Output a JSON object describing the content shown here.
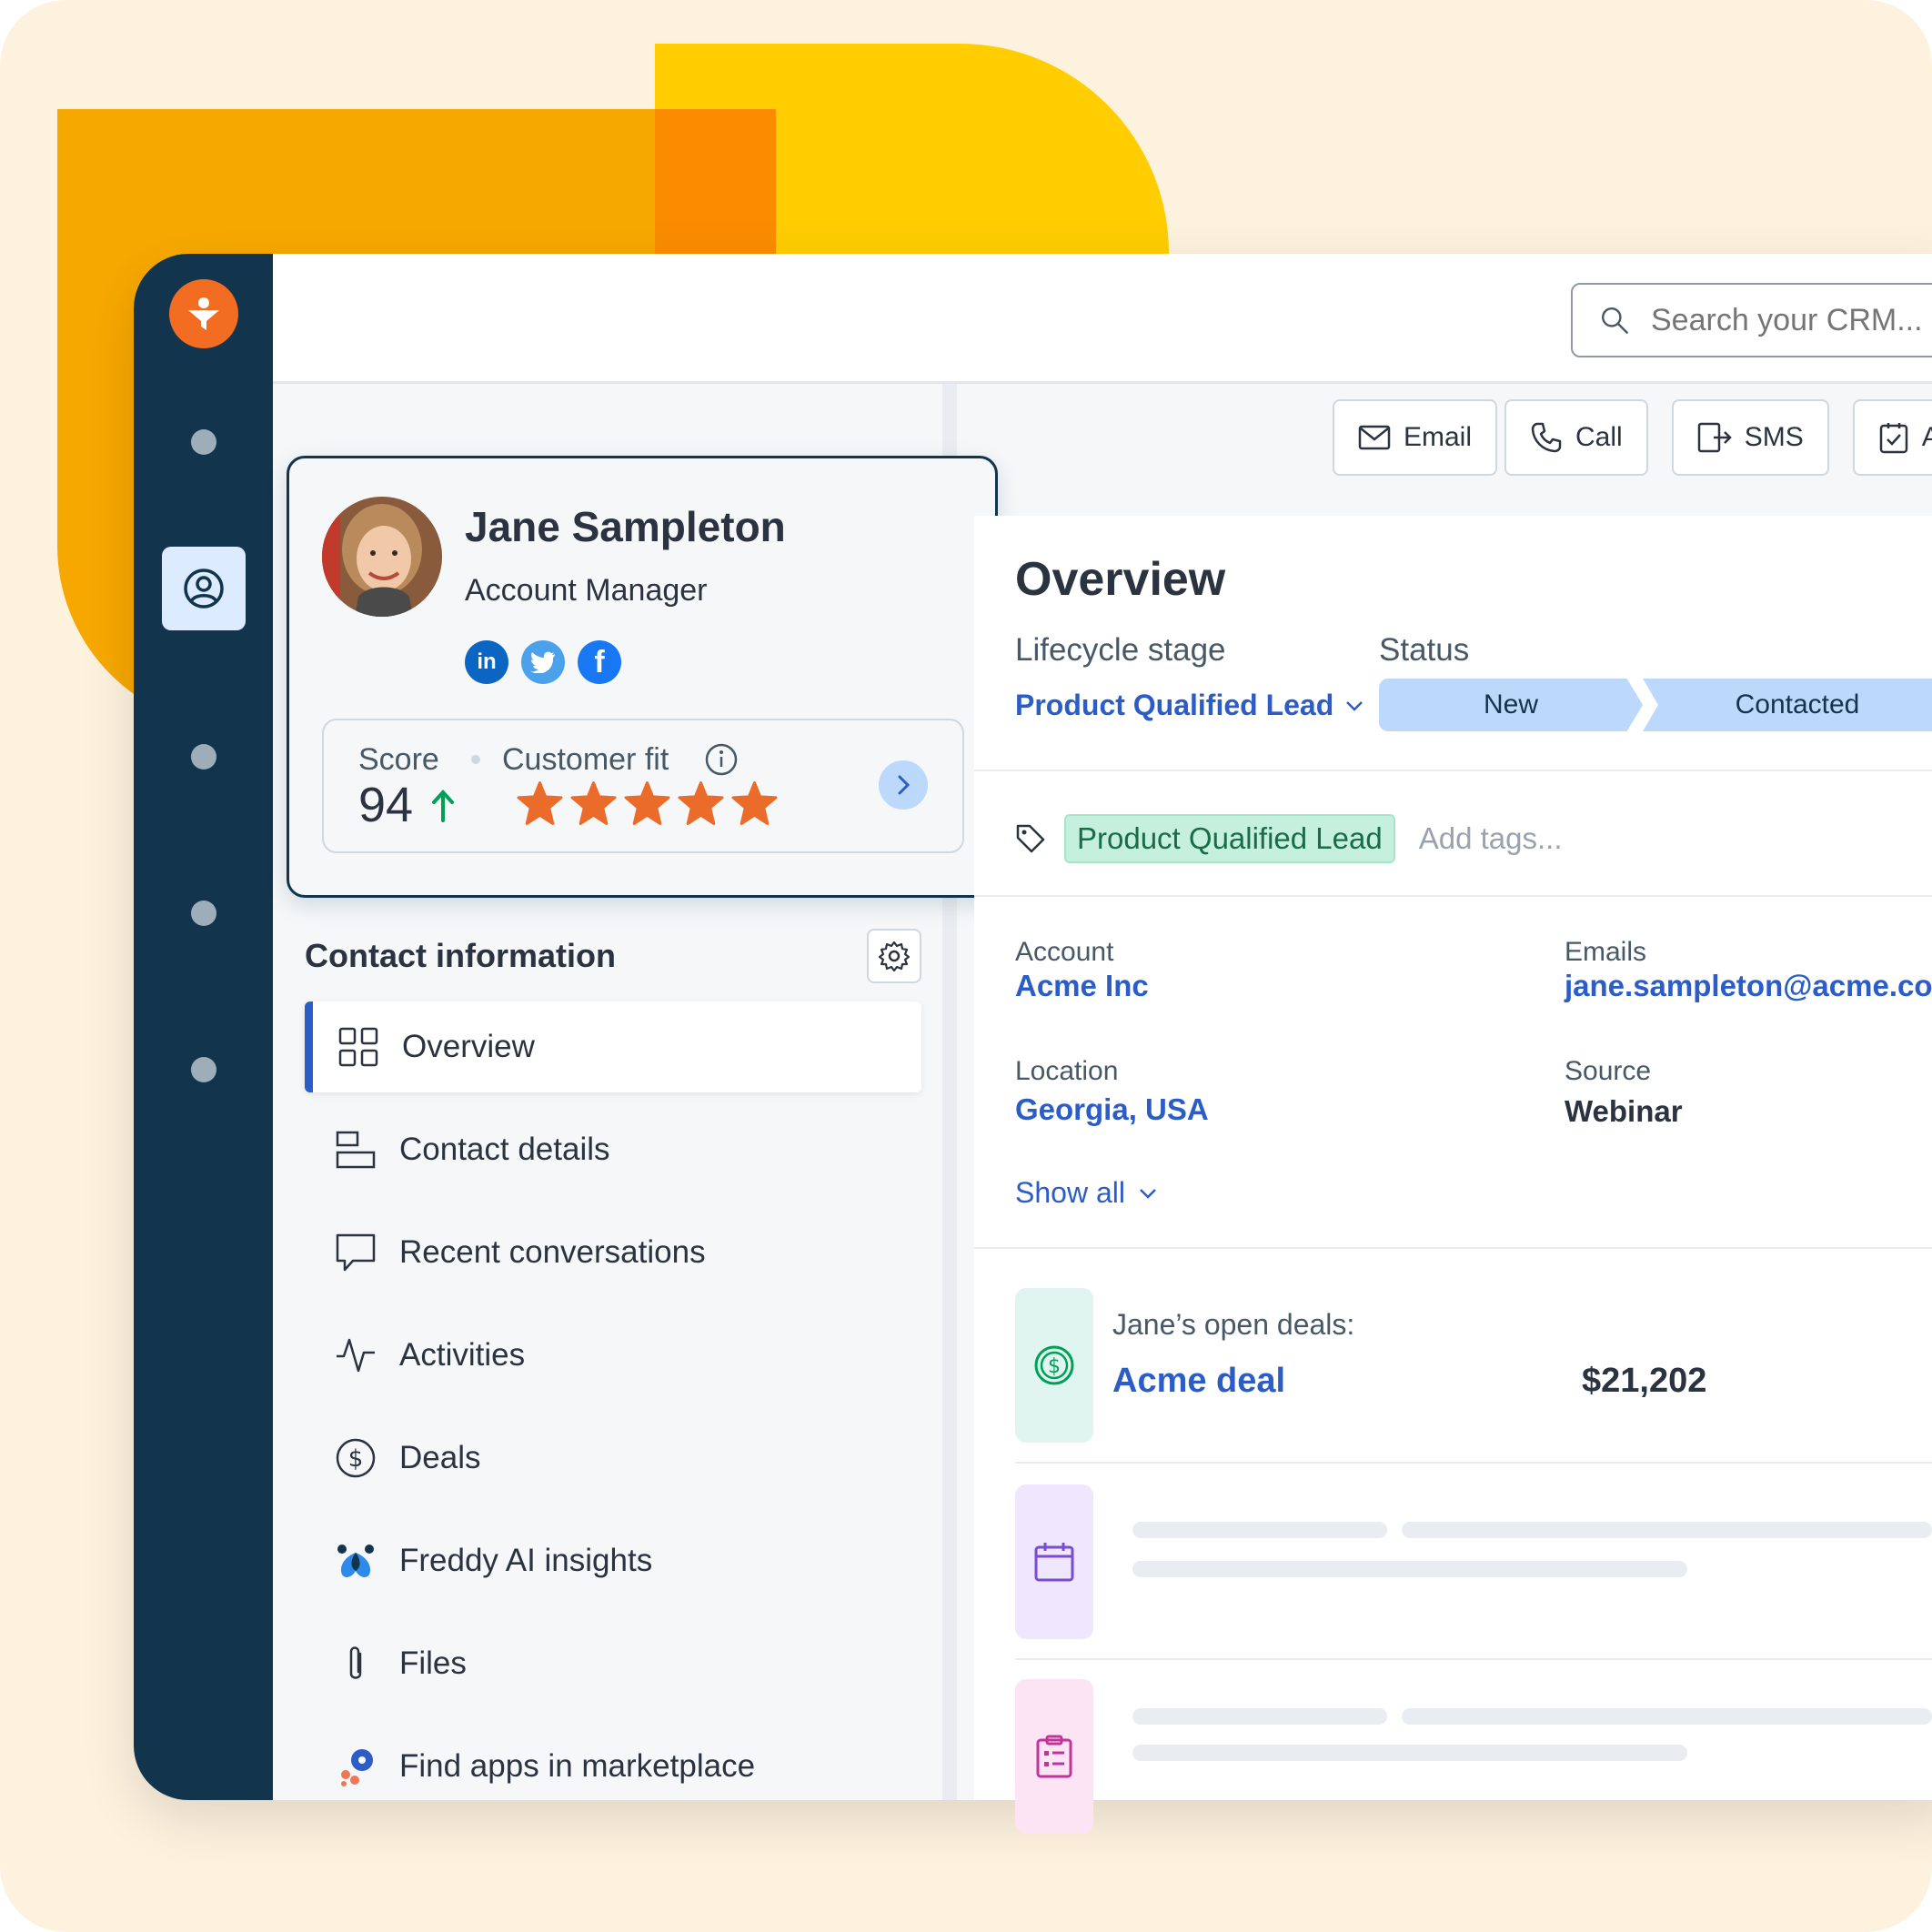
{
  "colors": {
    "background": "#fdf2de",
    "rail": "#12344d",
    "accent": "#2c5cc5",
    "logo": "#f26c22",
    "star": "#eb6c2a",
    "tag_bg": "#c5f0dd",
    "status_bg": "#bcd9fb"
  },
  "search": {
    "placeholder": "Search your CRM..."
  },
  "actions": [
    {
      "label": "Email",
      "icon": "mail-icon"
    },
    {
      "label": "Call",
      "icon": "phone-icon"
    },
    {
      "label": "SMS",
      "icon": "sms-icon"
    },
    {
      "label": "Ad",
      "icon": "task-icon"
    }
  ],
  "profile": {
    "name": "Jane Sampleton",
    "role": "Account Manager",
    "socials": [
      "linkedin",
      "twitter",
      "facebook"
    ],
    "score_label": "Score",
    "score": "94",
    "fit_label": "Customer fit",
    "fit_stars": 5
  },
  "contact_info": {
    "title": "Contact information",
    "items": [
      {
        "label": "Overview",
        "icon": "grid-icon",
        "active": true
      },
      {
        "label": "Contact details",
        "icon": "details-icon"
      },
      {
        "label": "Recent conversations",
        "icon": "chat-icon"
      },
      {
        "label": "Activities",
        "icon": "activity-icon"
      },
      {
        "label": "Deals",
        "icon": "dollar-icon"
      },
      {
        "label": "Freddy AI insights",
        "icon": "freddy-icon"
      },
      {
        "label": "Files",
        "icon": "paperclip-icon"
      },
      {
        "label": "Find apps in marketplace",
        "icon": "marketplace-icon"
      }
    ]
  },
  "overview": {
    "title": "Overview",
    "lifecycle_label": "Lifecycle stage",
    "lifecycle_value": "Product Qualified Lead",
    "status_label": "Status",
    "status_steps": [
      "New",
      "Contacted"
    ],
    "tag": "Product Qualified Lead",
    "tag_placeholder": "Add tags...",
    "fields": {
      "account_label": "Account",
      "account_value": "Acme Inc",
      "emails_label": "Emails",
      "emails_value": "jane.sampleton@acme.co",
      "location_label": "Location",
      "location_value": "Georgia, USA",
      "source_label": "Source",
      "source_value": "Webinar"
    },
    "show_all": "Show all",
    "deals_label": "Jane’s open deals:",
    "deal_name": "Acme deal",
    "deal_amount": "$21,202"
  }
}
